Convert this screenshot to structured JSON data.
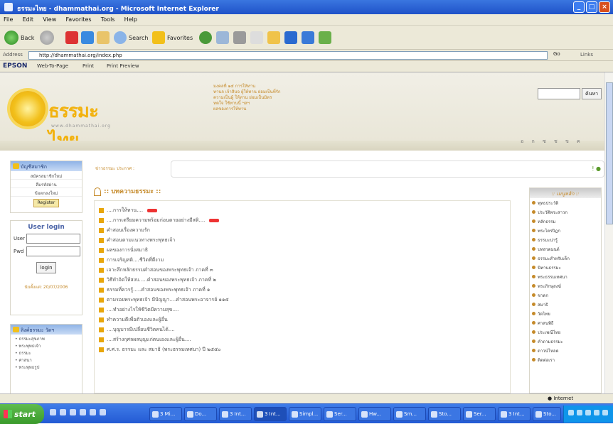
{
  "window": {
    "title": "ธรรมะไทย - dhammathai.org - Microsoft Internet Explorer"
  },
  "menu": [
    "File",
    "Edit",
    "View",
    "Favorites",
    "Tools",
    "Help"
  ],
  "toolbar": {
    "back": "Back",
    "search": "Search",
    "favorites": "Favorites"
  },
  "address": {
    "label": "Address",
    "url": "http://dhammathai.org/index.php",
    "go": "Go",
    "links": "Links"
  },
  "epson": {
    "brand": "EPSON",
    "webtopage": "Web-To-Page",
    "print": "Print",
    "preview": "Print Preview"
  },
  "site": {
    "logo_name": "ธรรมะไทย",
    "logo_url": "www.dhammathai.org",
    "header_text": [
      "มงคลที่ ๑๕ การให้ทาน",
      "ทานจ เจ้าสินจ ผู้ให้ทาน ย่อมเป็นที่รัก",
      "ความเป็นผู้ ให้ทาน ย่อมเป็นมิตร",
      "ทดใจ ใช้ทานนี้ ฯลฯ",
      "ผลของการให้ทาน"
    ],
    "search_button": "ค้นหา",
    "head_icons": [
      "อ",
      "ก",
      "ซ",
      "ช",
      "ข",
      "ค"
    ]
  },
  "left": {
    "members_title": "บัญชีสมาชิก",
    "members_items": [
      "สมัครสมาชิกใหม่",
      "ลืมรหัสผ่าน",
      "ข้อตกลงใหม่"
    ],
    "register_button": "Register",
    "login_title": "User login",
    "user_label": "User",
    "pwd_label": "Pwd",
    "login_button": "login",
    "counter": "นับตั้งแต่: 20/07/2006",
    "links_title": "ลิงค์ธรรมะ วัดฯ",
    "links_items": [
      "• ธรรมะสุขภาพ",
      "• พระพุทธเจ้า",
      "• ธรรมะ",
      "• ศาสนา",
      "• พระพุทธรูป"
    ]
  },
  "main": {
    "ticker_label": "ข่าวธรรมะ ประกาศ :",
    "section_title": ":: บทความธรรมะ ::",
    "articles": [
      {
        "text": "....การให้ทาน....",
        "new": true
      },
      {
        "text": "....การเตรียมความพร้อมก่อนตายอย่างมีสติ....",
        "new": true
      },
      {
        "text": "คำสอนเรื่องความรัก",
        "new": false
      },
      {
        "text": "คำสอนตามแนวทางพระพุทธเจ้า",
        "new": false
      },
      {
        "text": "ผลของการนั่งสมาธิ",
        "new": false
      },
      {
        "text": "การเจริญสติ....ชีวิตที่ดีงาม",
        "new": false
      },
      {
        "text": "เจาะลึกหลักธรรมคำสอนของพระพุทธเจ้า ภาคที่ ๓",
        "new": false
      },
      {
        "text": "วิธีทำจิตให้สงบ.....คำสอนของพระพุทธเจ้า ภาคที่ ๒",
        "new": false
      },
      {
        "text": "ธรรมที่ควรรู้.....คำสอนของพระพุทธเจ้า ภาคที่ ๑",
        "new": false
      },
      {
        "text": "ตามรอยพระพุทธเจ้า มีปัญญา....คำสอนพระอาจารย์ ๑๑๕",
        "new": false
      },
      {
        "text": "....ทำอย่างไรให้ชีวิตมีความสุข....",
        "new": false
      },
      {
        "text": "ทำความดีเพื่อตัวเองและผู้อื่น",
        "new": false
      },
      {
        "text": "....บุญบารมีเปลี่ยนชีวิตคนได้....",
        "new": false
      },
      {
        "text": "....สร้างกุศลผลบุญแก่ตนเองและผู้อื่น....",
        "new": false
      },
      {
        "text": "ศ.ศ.ร. ธรรมะ และ สมาธิ (พระธรรมเทศนา) ปี ๒๕๕๐",
        "new": false
      }
    ]
  },
  "right": {
    "title": ":: เมนูหลัก ::",
    "items": [
      "พุทธประวัติ",
      "ประวัติพระสาวก",
      "หลักธรรม",
      "พระไตรปิฎก",
      "ธรรมะน่ารู้",
      "บทสวดมนต์",
      "ธรรมะสำหรับเด็ก",
      "นิทานธรรมะ",
      "พระธรรมเทศนา",
      "พระภิกษุสงฆ์",
      "ชาดก",
      "สมาธิ",
      "วัดไทย",
      "ศาสนพิธี",
      "ประเพณีไทย",
      "คำถามธรรมะ",
      "ดาวน์โหลด",
      "ติดต่อเรา"
    ]
  },
  "status": {
    "zone": "Internet"
  },
  "taskbar": {
    "start": "start",
    "tasks": [
      "3 Mi...",
      "Do...",
      "3 Int...",
      "3 Int...",
      "Simpl...",
      "Ser...",
      "Hw...",
      "Sm...",
      "Sto...",
      "Ser...",
      "3 Int...",
      "Sto..."
    ]
  }
}
